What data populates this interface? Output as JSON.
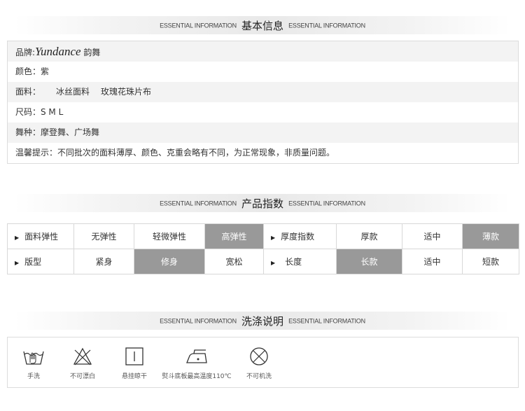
{
  "sections": {
    "basic": {
      "en_left": "ESSENTIAL INFORMATION",
      "zh": "基本信息",
      "en_right": "ESSENTIAL INFORMATION"
    },
    "product": {
      "en_left": "ESSENTIAL INFORMATION",
      "zh": "产品指数",
      "en_right": "ESSENTIAL INFORMATION"
    },
    "wash": {
      "en_left": "ESSENTIAL INFORMATION",
      "zh": "洗涤说明",
      "en_right": "ESSENTIAL INFORMATION"
    }
  },
  "basic_info": {
    "brand_label": "品牌:",
    "brand_en": "Yundance",
    "brand_zh": "韵舞",
    "color": "颜色：紫",
    "fabric_label": "面料：",
    "fabric_value1": "冰丝面料",
    "fabric_value2": "玫瑰花珠片布",
    "size": "尺码：S M L",
    "dance": "舞种：摩登舞、广场舞",
    "note": "温馨提示：不同批次的面料薄厚、颜色、克重会略有不同，为正常现象，非质量问题。"
  },
  "product_index": {
    "row1": {
      "left_label": "面料弹性",
      "left_options": [
        "无弹性",
        "轻微弹性",
        "高弹性"
      ],
      "left_selected": 2,
      "right_label": "厚度指数",
      "right_options": [
        "厚款",
        "适中",
        "薄款"
      ],
      "right_selected": 2
    },
    "row2": {
      "left_label": "版型",
      "left_options": [
        "紧身",
        "修身",
        "宽松"
      ],
      "left_selected": 1,
      "right_label": "长度",
      "right_options": [
        "长款",
        "适中",
        "短款"
      ],
      "right_selected": 0
    }
  },
  "wash_items": [
    {
      "icon": "hand-wash-icon",
      "label": "手洗"
    },
    {
      "icon": "no-bleach-icon",
      "label": "不可漂白"
    },
    {
      "icon": "hang-dry-icon",
      "label": "悬挂晾干"
    },
    {
      "icon": "iron-110-icon",
      "label": "熨斗底板最高温度110℃"
    },
    {
      "icon": "no-machine-wash-icon",
      "label": "不可机洗"
    }
  ],
  "colors": {
    "selected_bg": "#999999",
    "row_alt": "#f3f3f3",
    "border": "#dcdcdc"
  }
}
